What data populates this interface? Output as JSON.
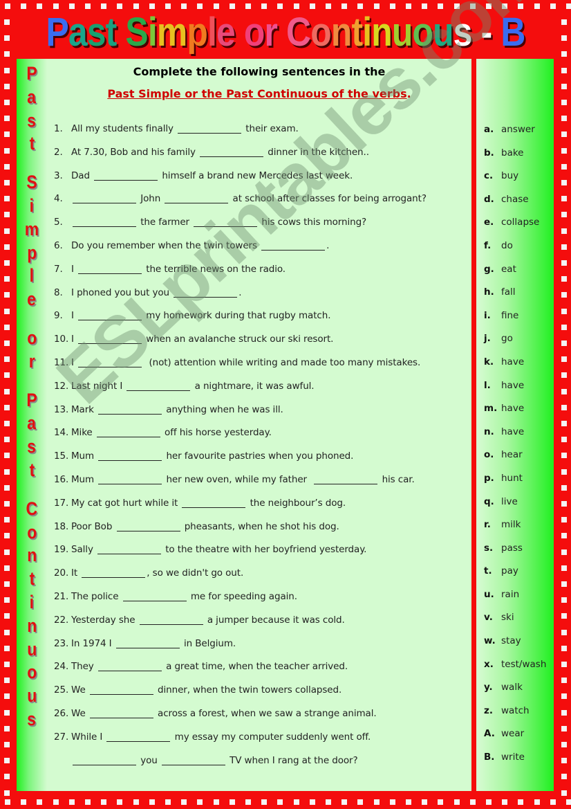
{
  "title": {
    "text": "Past Simple or Continuous - B",
    "letter_colors": [
      "#3a6df0",
      "#1aa58a",
      "#18a070",
      "#1aa080",
      "#ffffff",
      "#2aa84a",
      "#7ac83a",
      "#e8c020",
      "#f07a20",
      "#f0505a",
      "#e84a7a",
      "#ffffff",
      "#f0407a",
      "#f05090",
      "#ffffff",
      "#f05a8a",
      "#f06a60",
      "#f08a40",
      "#f0a030",
      "#e8c020",
      "#d8d820",
      "#a0d030",
      "#60c050",
      "#20a880",
      "#ffffff",
      "#20a0a0",
      "#ffffff",
      "#3a6df0"
    ]
  },
  "side_strip": {
    "words": [
      "Past",
      "Simple",
      "or",
      "Past",
      "Continuous"
    ]
  },
  "instructions": {
    "line1": "Complete the following sentences in the",
    "line2": "Past Simple or the Past Continuous of the verbs",
    "line2_suffix": "."
  },
  "sentences": [
    {
      "num": "1.",
      "parts": [
        "All my students finally ",
        "_",
        " their exam."
      ]
    },
    {
      "num": "2.",
      "parts": [
        "At 7.30, Bob and his family ",
        "_",
        " dinner in the kitchen.."
      ]
    },
    {
      "num": "3.",
      "parts": [
        "Dad ",
        "_",
        " himself a brand new Mercedes last week."
      ]
    },
    {
      "num": "4.",
      "parts": [
        "",
        "_",
        " John ",
        "_",
        " at school after classes for being arrogant?"
      ]
    },
    {
      "num": "5.",
      "parts": [
        "",
        "_",
        " the farmer ",
        "_",
        " his cows this morning?"
      ]
    },
    {
      "num": "6.",
      "parts": [
        "Do you remember when the twin towers ",
        "_",
        "."
      ]
    },
    {
      "num": "7.",
      "parts": [
        "I ",
        "_",
        " the terrible news on the radio."
      ]
    },
    {
      "num": "8.",
      "parts": [
        "I phoned you but you ",
        "_",
        "."
      ]
    },
    {
      "num": "9.",
      "parts": [
        "I ",
        "_",
        " my homework during that rugby match."
      ]
    },
    {
      "num": "10.",
      "parts": [
        "I ",
        "_",
        " when an avalanche struck our ski resort."
      ]
    },
    {
      "num": "11.",
      "parts": [
        "I ",
        "_",
        "  (not) attention while writing and made too many mistakes."
      ]
    },
    {
      "num": "12.",
      "parts": [
        "Last night I ",
        "_",
        " a nightmare, it was awful."
      ]
    },
    {
      "num": "13.",
      "parts": [
        "Mark ",
        "_",
        " anything when he was ill."
      ]
    },
    {
      "num": "14.",
      "parts": [
        "Mike ",
        "_",
        " off his horse yesterday."
      ]
    },
    {
      "num": "15.",
      "parts": [
        "Mum ",
        "_",
        " her favourite pastries when you phoned."
      ]
    },
    {
      "num": "16.",
      "parts": [
        "Mum ",
        "_",
        " her new oven, while my father  ",
        "_",
        " his car."
      ]
    },
    {
      "num": "17.",
      "parts": [
        "My cat got hurt while it ",
        "_",
        " the neighbour’s dog."
      ]
    },
    {
      "num": "18.",
      "parts": [
        "Poor Bob ",
        "_",
        " pheasants, when he shot his dog."
      ]
    },
    {
      "num": "19.",
      "parts": [
        "Sally ",
        "_",
        " to the theatre with her boyfriend yesterday."
      ]
    },
    {
      "num": "20.",
      "parts": [
        "It ",
        "_",
        ", so we didn't go out."
      ]
    },
    {
      "num": "21.",
      "parts": [
        "The police ",
        "_",
        " me for speeding again."
      ]
    },
    {
      "num": "22.",
      "parts": [
        "Yesterday she ",
        "_",
        " a jumper because it was cold."
      ]
    },
    {
      "num": "23.",
      "parts": [
        "In 1974 I ",
        "_",
        " in Belgium."
      ]
    },
    {
      "num": "24.",
      "parts": [
        "They ",
        "_",
        " a great time, when the teacher arrived."
      ]
    },
    {
      "num": "25.",
      "parts": [
        "We ",
        "_",
        " dinner, when the twin towers collapsed."
      ]
    },
    {
      "num": "26.",
      "parts": [
        "We ",
        "_",
        " across a forest, when we saw a strange animal."
      ]
    },
    {
      "num": "27.",
      "parts": [
        "While I ",
        "_",
        " my essay my computer suddenly went off."
      ]
    },
    {
      "num": "",
      "parts": [
        "",
        "_",
        " you ",
        "_",
        " TV when I rang at the door?"
      ]
    }
  ],
  "word_bank": [
    {
      "letter": "a.",
      "word": "answer"
    },
    {
      "letter": "b.",
      "word": "bake"
    },
    {
      "letter": "c.",
      "word": "buy"
    },
    {
      "letter": "d.",
      "word": "chase"
    },
    {
      "letter": "e.",
      "word": "collapse"
    },
    {
      "letter": "f.",
      "word": "do"
    },
    {
      "letter": "g.",
      "word": "eat"
    },
    {
      "letter": "h.",
      "word": "fall"
    },
    {
      "letter": "i.",
      "word": "fine"
    },
    {
      "letter": "j.",
      "word": "go"
    },
    {
      "letter": "k.",
      "word": "have"
    },
    {
      "letter": "l.",
      "word": "have"
    },
    {
      "letter": "m.",
      "word": "have"
    },
    {
      "letter": "n.",
      "word": "have"
    },
    {
      "letter": "o.",
      "word": "hear"
    },
    {
      "letter": "p.",
      "word": "hunt"
    },
    {
      "letter": "q.",
      "word": "live"
    },
    {
      "letter": "r.",
      "word": "milk"
    },
    {
      "letter": "s.",
      "word": "pass"
    },
    {
      "letter": "t.",
      "word": "pay"
    },
    {
      "letter": "u.",
      "word": "rain"
    },
    {
      "letter": "v.",
      "word": "ski"
    },
    {
      "letter": "w.",
      "word": "stay"
    },
    {
      "letter": "x.",
      "word": "test/wash"
    },
    {
      "letter": "y.",
      "word": "walk"
    },
    {
      "letter": "z.",
      "word": "watch"
    },
    {
      "letter": "A.",
      "word": "wear"
    },
    {
      "letter": "B.",
      "word": "write"
    }
  ],
  "watermark": "ESLprintables.com",
  "colors": {
    "frame_red": "#f40d0d",
    "panel_green": "#d4fbd0",
    "accent_green": "#20f020",
    "instruction_red": "#d00000"
  }
}
